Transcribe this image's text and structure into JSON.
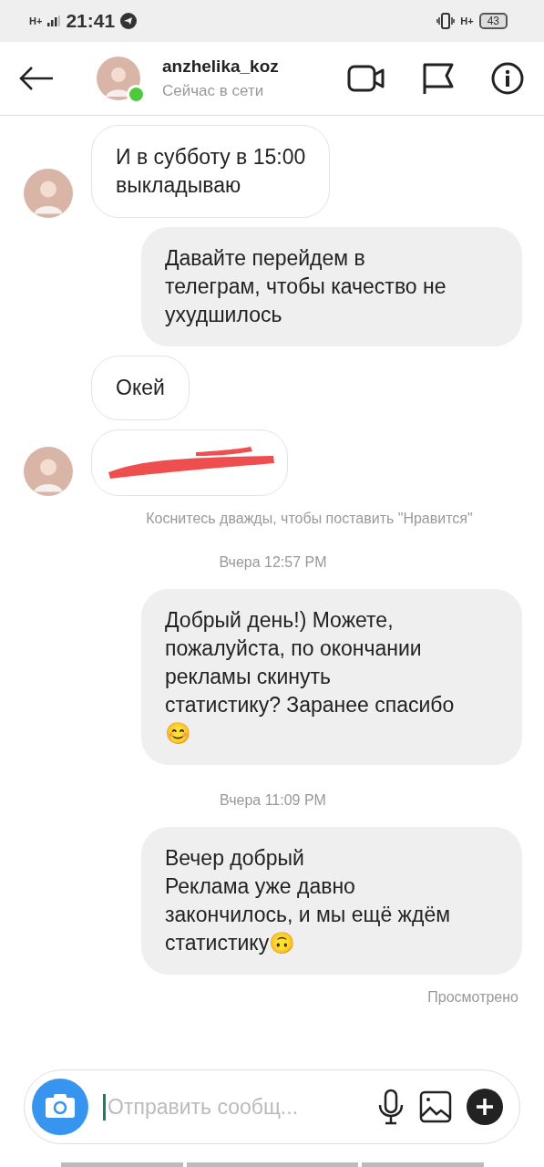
{
  "status_bar": {
    "time": "21:41",
    "network_left": "H+",
    "network_right": "H+",
    "battery": "43"
  },
  "header": {
    "username": "anzhelika_koz",
    "status": "Сейчас в сети",
    "online": true
  },
  "messages": [
    {
      "kind": "incoming",
      "text": "И в субботу в 15:00\nвыкладываю",
      "avatar": true
    },
    {
      "kind": "outgoing",
      "text": "Давайте перейдем в\nтелеграм, чтобы качество не\nухудшилось"
    },
    {
      "kind": "incoming",
      "text": "Окей",
      "avatar": false
    },
    {
      "kind": "redacted",
      "avatar": true
    },
    {
      "kind": "hint",
      "text": "Коснитесь дважды, чтобы поставить \"Нравится\""
    },
    {
      "kind": "time",
      "text": "Вчера 12:57 PM"
    },
    {
      "kind": "outgoing",
      "text": "Добрый день!) Можете,\nпожалуйста, по окончании\nрекламы скинуть\nстатистику? Заранее спасибо\n😊"
    },
    {
      "kind": "time",
      "text": "Вчера 11:09 PM"
    },
    {
      "kind": "outgoing",
      "text": "Вечер добрый\nРеклама уже давно\nзакончилось, и мы ещё ждём\nстатистику🙃"
    },
    {
      "kind": "seen",
      "text": "Просмотрено"
    }
  ],
  "composer": {
    "placeholder": "Отправить сообщ..."
  }
}
